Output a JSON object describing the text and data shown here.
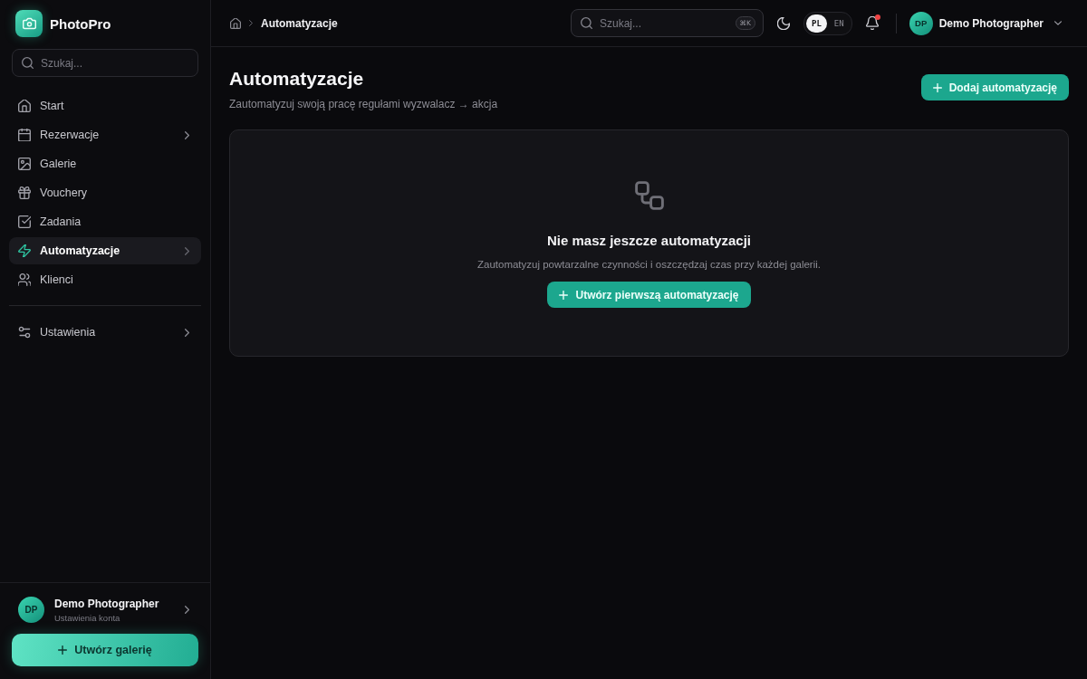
{
  "sidebar": {
    "brand": "PhotoPro",
    "search": {
      "placeholder": "Szukaj..."
    },
    "nav_items": [
      {
        "label": "Start",
        "expandable": false,
        "selected": false
      },
      {
        "label": "Rezerwacje",
        "expandable": true,
        "selected": false
      },
      {
        "label": "Galerie",
        "expandable": false,
        "selected": false
      },
      {
        "label": "Vouchery",
        "expandable": false,
        "selected": false
      },
      {
        "label": "Zadania",
        "expandable": false,
        "selected": false
      },
      {
        "label": "Automatyzacje",
        "expandable": true,
        "selected": true
      },
      {
        "label": "Klienci",
        "expandable": false,
        "selected": false
      }
    ],
    "footer_nav_items": [
      {
        "label": "Ustawienia",
        "expandable": true,
        "selected": false
      }
    ],
    "account": {
      "initials": "DP",
      "name": "Demo Photographer",
      "subtitle": "Ustawienia konta"
    },
    "create_button": "Utwórz galerię"
  },
  "topbar": {
    "breadcrumb": {
      "current": "Automatyzacje"
    },
    "search": {
      "placeholder": "Szukaj...",
      "shortcut": "⌘K"
    },
    "languages": [
      {
        "label": "PL",
        "selected": true
      },
      {
        "label": "EN",
        "selected": false
      }
    ],
    "notifications": {
      "unread": true
    },
    "user": {
      "initials": "DP",
      "name": "Demo Photographer"
    }
  },
  "page": {
    "title": "Automatyzacje",
    "subtitle": "Zautomatyzuj swoją pracę regułami wyzwalacz → akcja",
    "add_button": "Dodaj automatyzację",
    "empty_state": {
      "title": "Nie masz jeszcze automatyzacji",
      "text": "Zautomatyzuj powtarzalne czynności i oszczędzaj czas przy każdej galerii.",
      "button": "Utwórz pierwszą automatyzację"
    }
  }
}
